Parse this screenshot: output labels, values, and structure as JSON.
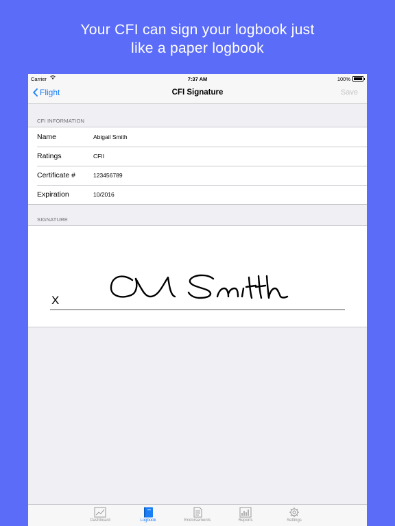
{
  "headline": {
    "line1": "Your CFI can sign your logbook just",
    "line2": "like a paper logbook"
  },
  "status_bar": {
    "carrier": "Carrier",
    "time": "7:37 AM",
    "battery": "100%"
  },
  "nav": {
    "back_label": "Flight",
    "title": "CFI Signature",
    "save_label": "Save"
  },
  "cfi_information": {
    "header": "CFI INFORMATION",
    "rows": [
      {
        "label": "Name",
        "value": "Abigail Smith"
      },
      {
        "label": "Ratings",
        "value": "CFII"
      },
      {
        "label": "Certificate #",
        "value": "123456789"
      },
      {
        "label": "Expiration",
        "value": "10/2016"
      }
    ]
  },
  "signature": {
    "header": "SIGNATURE",
    "x_mark": "X"
  },
  "tab_bar": {
    "active_index": 1,
    "tabs": [
      {
        "label": "Dashboard",
        "icon": "chart-icon"
      },
      {
        "label": "Logbook",
        "icon": "book-icon"
      },
      {
        "label": "Endorsements",
        "icon": "document-icon"
      },
      {
        "label": "Reports",
        "icon": "bar-chart-icon"
      },
      {
        "label": "Settings",
        "icon": "gear-icon"
      }
    ]
  },
  "colors": {
    "background": "#5b6cf9",
    "accent": "#1a7ef5",
    "disabled": "#c4c4c7"
  }
}
